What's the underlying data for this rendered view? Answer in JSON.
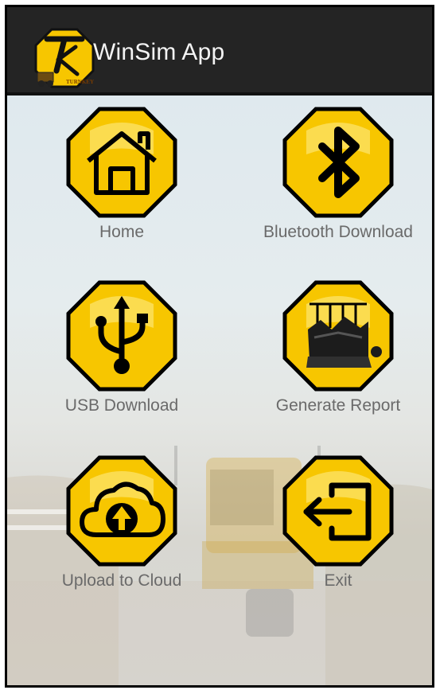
{
  "app_bar": {
    "title": "WinSim App",
    "logo_text": "TURNKEY",
    "background": "#242424"
  },
  "menu": {
    "items": [
      {
        "id": "home",
        "label": "Home",
        "icon": "home-icon"
      },
      {
        "id": "bluetooth",
        "label": "Bluetooth Download",
        "icon": "bluetooth-icon"
      },
      {
        "id": "usb",
        "label": "USB Download",
        "icon": "usb-icon"
      },
      {
        "id": "report",
        "label": "Generate Report",
        "icon": "report-icon"
      },
      {
        "id": "cloud",
        "label": "Upload to Cloud",
        "icon": "cloud-upload-icon"
      },
      {
        "id": "exit",
        "label": "Exit",
        "icon": "exit-icon"
      }
    ]
  },
  "colors": {
    "icon_yellow": "#f7c600",
    "icon_outline": "#000000",
    "label": "#6a6a6a"
  }
}
